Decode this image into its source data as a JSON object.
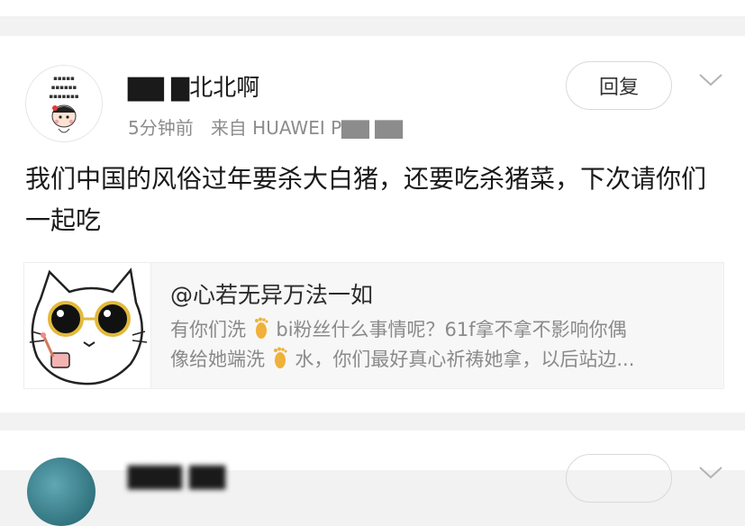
{
  "comment": {
    "username": "▇▇ ▇北北啊",
    "time": "5分钟前",
    "source": "来自 HUAWEI P▇▇ ▇▇",
    "reply_label": "回复",
    "text": "我们中国的风俗过年要杀大白猪，还要吃杀猪菜，下次请你们一起吃"
  },
  "quoted": {
    "user": "@心若无异万法一如",
    "line1_a": "有你们洗",
    "line1_b": "bi粉丝什么事情呢？61f拿不拿不影响你偶",
    "line2_a": "像给她端洗",
    "line2_b": "水，你们最好真心祈祷她拿，以后站边..."
  },
  "next_comment": {
    "username": "▇▇▇ ▇▇"
  },
  "icons": {
    "avatar": "cartoon-girl-avatar",
    "chevron": "chevron-down-icon",
    "foot": "foot-emoji-icon",
    "quote_image": "cat-with-sunglasses-sticker"
  }
}
